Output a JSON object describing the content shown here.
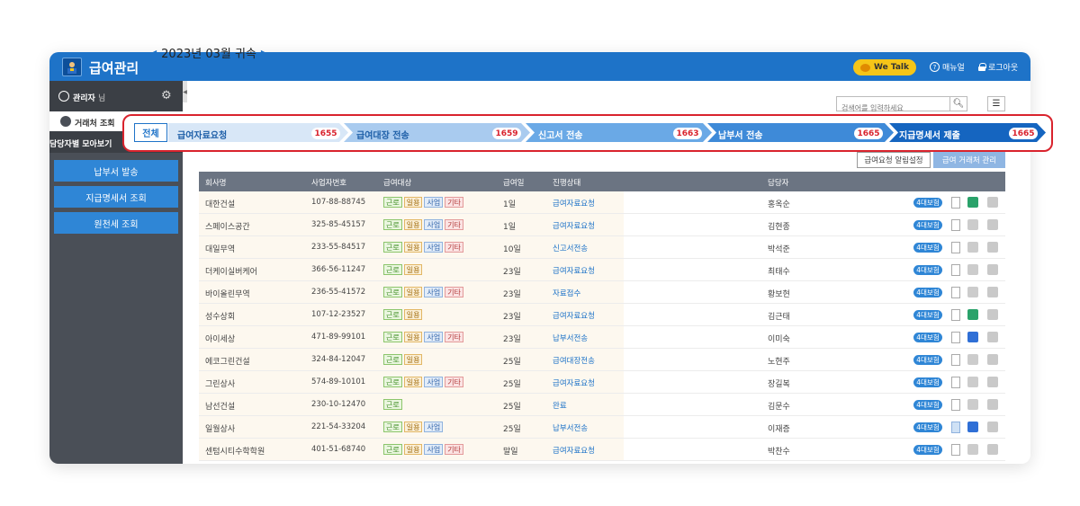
{
  "header": {
    "app_title": "급여관리",
    "wetalk_label": "We Talk",
    "manual_label": "매뉴얼",
    "logout_label": "로그아웃"
  },
  "sidebar": {
    "user_name": "관리자",
    "user_suffix": "님",
    "active_menu": "거래처 조회",
    "section_title": "담당자별 모아보기",
    "buttons": [
      "납부서 발송",
      "지급명세서 조회",
      "원천세 조회"
    ]
  },
  "toolbar": {
    "period": "2023년 03월 귀속",
    "search_placeholder": "검색어를 입력하세요"
  },
  "progress": {
    "all_label": "전체",
    "steps": [
      {
        "label": "급여자료요청",
        "count": "1655"
      },
      {
        "label": "급여대장 전송",
        "count": "1659"
      },
      {
        "label": "신고서 전송",
        "count": "1663"
      },
      {
        "label": "납부서 전송",
        "count": "1665"
      },
      {
        "label": "지급명세서 제출",
        "count": "1665"
      }
    ]
  },
  "actions": {
    "notify_settings": "급여요청 알림설정",
    "client_manage": "급여 거래처 관리"
  },
  "table": {
    "headers": [
      "회사명",
      "사업자번호",
      "급여대상",
      "급여일",
      "진행상태",
      "담당자"
    ],
    "insurance_label": "4대보험",
    "tag_labels": {
      "g": "근로",
      "y": "일용",
      "b": "사업",
      "r": "기타"
    },
    "rows": [
      {
        "company": "대한건설",
        "biz": "107-88-88745",
        "tags": [
          "g",
          "y",
          "b",
          "r"
        ],
        "payday": "1일",
        "status": "급여자료요청",
        "manager": "홍옥순",
        "app": "green"
      },
      {
        "company": "스페이스공간",
        "biz": "325-85-45157",
        "tags": [
          "g",
          "y",
          "b",
          "r"
        ],
        "payday": "1일",
        "status": "급여자료요청",
        "manager": "김현종",
        "app": "gray"
      },
      {
        "company": "대일무역",
        "biz": "233-55-84517",
        "tags": [
          "g",
          "y",
          "b",
          "r"
        ],
        "payday": "10일",
        "status": "신고서전송",
        "manager": "박석준",
        "app": "gray"
      },
      {
        "company": "더케이실버케어",
        "biz": "366-56-11247",
        "tags": [
          "g",
          "y"
        ],
        "payday": "23일",
        "status": "급여자료요청",
        "manager": "최태수",
        "app": "gray"
      },
      {
        "company": "바이올린무역",
        "biz": "236-55-41572",
        "tags": [
          "g",
          "y",
          "b",
          "r"
        ],
        "payday": "23일",
        "status": "자료접수",
        "manager": "황보현",
        "app": "gray"
      },
      {
        "company": "성수상회",
        "biz": "107-12-23527",
        "tags": [
          "g",
          "y"
        ],
        "payday": "23일",
        "status": "급여자료요청",
        "manager": "김근태",
        "app": "green"
      },
      {
        "company": "아이세상",
        "biz": "471-89-99101",
        "tags": [
          "g",
          "y",
          "b",
          "r"
        ],
        "payday": "23일",
        "status": "납부서전송",
        "manager": "이미숙",
        "app": "blue"
      },
      {
        "company": "에코그린건설",
        "biz": "324-84-12047",
        "tags": [
          "g",
          "y"
        ],
        "payday": "25일",
        "status": "급여대장전송",
        "manager": "노현주",
        "app": "gray"
      },
      {
        "company": "그린상사",
        "biz": "574-89-10101",
        "tags": [
          "g",
          "y",
          "b",
          "r"
        ],
        "payday": "25일",
        "status": "급여자료요청",
        "manager": "장길복",
        "app": "gray"
      },
      {
        "company": "남선건설",
        "biz": "230-10-12470",
        "tags": [
          "g"
        ],
        "payday": "25일",
        "status": "완료",
        "manager": "김문수",
        "app": "gray"
      },
      {
        "company": "일월상사",
        "biz": "221-54-33204",
        "tags": [
          "g",
          "y",
          "b"
        ],
        "payday": "25일",
        "status": "납부서전송",
        "manager": "이재증",
        "app": "blue"
      },
      {
        "company": "센텀시티수학학원",
        "biz": "401-51-68740",
        "tags": [
          "g",
          "y",
          "b",
          "r"
        ],
        "payday": "말일",
        "status": "급여자료요청",
        "manager": "박찬수",
        "app": "gray"
      }
    ]
  },
  "colors": {
    "brand_blue": "#1e73c8",
    "highlight_red": "#d9232d",
    "sidebar_dark": "#4a4f57"
  }
}
